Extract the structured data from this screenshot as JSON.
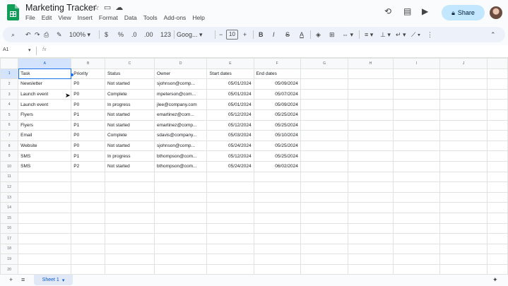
{
  "doc": {
    "title": "Marketing Tracker"
  },
  "menu": [
    "File",
    "Edit",
    "View",
    "Insert",
    "Format",
    "Data",
    "Tools",
    "Add-ons",
    "Help"
  ],
  "header": {
    "share_label": "Share"
  },
  "toolbar": {
    "zoom": "100%",
    "currency": "$",
    "percent": "%",
    "dec_decrease": ".0",
    "dec_increase": ".00",
    "number_format": "123",
    "font": "Goog...",
    "font_size": "10",
    "minus": "−",
    "plus": "+",
    "bold": "B",
    "italic": "I"
  },
  "namebox": "A1",
  "fx_symbol": "fx",
  "columns": [
    "A",
    "B",
    "C",
    "D",
    "E",
    "F",
    "G",
    "H",
    "I",
    "J"
  ],
  "rows": [
    [
      "Task",
      "Priority",
      "Status",
      "Owner",
      "Start dates",
      "End dates"
    ],
    [
      "Newsletter",
      "P0",
      "Not started",
      "sjohnson@comp...",
      "05/01/2024",
      "05/09/2024"
    ],
    [
      "Launch event",
      "P0",
      "Complete",
      "mpeterson@com...",
      "05/01/2024",
      "05/07/2024"
    ],
    [
      "Launch event",
      "P0",
      "In progress",
      "jlee@company.com",
      "05/01/2024",
      "05/09/2024"
    ],
    [
      "Flyers",
      "P1",
      "Not started",
      "emartinez@com...",
      "05/12/2024",
      "05/25/2024"
    ],
    [
      "Flyers",
      "P1",
      "Not started",
      "emartinez@comp...",
      "05/12/2024",
      "05/25/2024"
    ],
    [
      "Email",
      "P0",
      "Complete",
      "sdavis@company...",
      "05/03/2024",
      "05/10/2024"
    ],
    [
      "Website",
      "P0",
      "Not started",
      "sjohnson@comp...",
      "05/24/2024",
      "05/25/2024"
    ],
    [
      "SMS",
      "P1",
      "In progress",
      "bthompson@com...",
      "05/12/2024",
      "05/25/2024"
    ],
    [
      "SMS",
      "P2",
      "Not started",
      "bthompson@com...",
      "05/24/2024",
      "06/02/2024"
    ]
  ],
  "row_numbers": [
    "1",
    "2",
    "3",
    "4",
    "5",
    "6",
    "7",
    "8",
    "9",
    "10",
    "11",
    "12",
    "13",
    "14",
    "15",
    "16",
    "17",
    "18",
    "19",
    "20"
  ],
  "sheet": {
    "tab_label": "Sheet 1"
  }
}
